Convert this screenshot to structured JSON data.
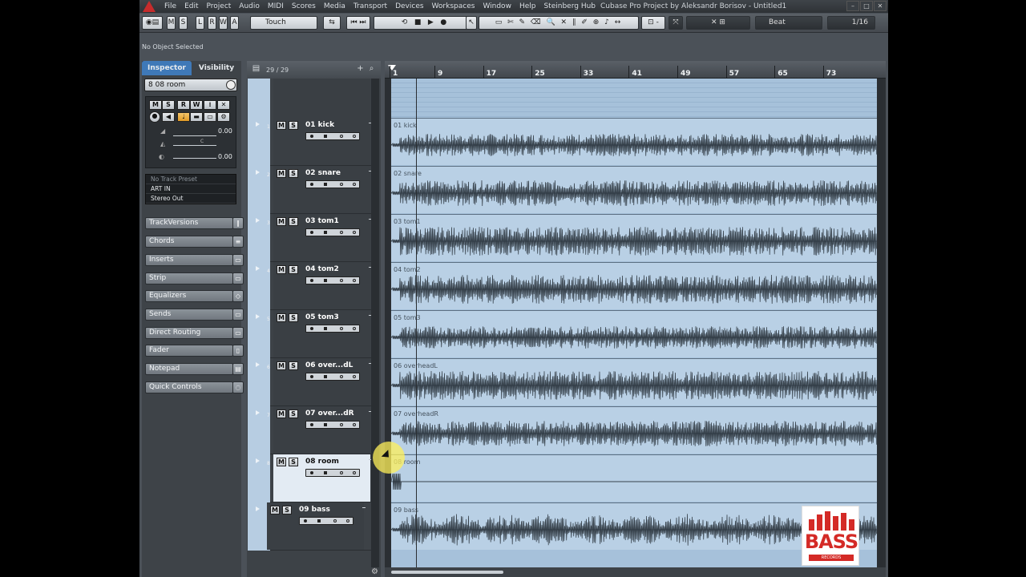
{
  "menubar": {
    "items": [
      "File",
      "Edit",
      "Project",
      "Audio",
      "MIDI",
      "Scores",
      "Media",
      "Transport",
      "Devices",
      "Workspaces",
      "Window",
      "Help",
      "Steinberg Hub"
    ],
    "window_title": "Cubase Pro Project by Aleksandr Borisov - Untitled1"
  },
  "toolbar": {
    "states": [
      "M",
      "S",
      "L",
      "R",
      "W",
      "A"
    ],
    "automation_mode": "Touch",
    "snap_type": "Beat",
    "quantize": "1/16"
  },
  "infoline": {
    "text": "No Object Selected"
  },
  "inspector": {
    "tabs": [
      "Inspector",
      "Visibility"
    ],
    "track_name": "08 room",
    "track_num": "8",
    "volume": "0.00",
    "pan": "C",
    "delay": "0.00",
    "track_preset": "No Track Preset",
    "input": "ART IN",
    "output": "Stereo Out",
    "sections": [
      "TrackVersions",
      "Chords",
      "Inserts",
      "Strip",
      "Equalizers",
      "Sends",
      "Direct Routing",
      "Fader",
      "Notepad",
      "Quick Controls"
    ]
  },
  "tracklist": {
    "count": "29 / 29",
    "tracks": [
      {
        "num": "1",
        "name": "01 kick"
      },
      {
        "num": "2",
        "name": "02 snare"
      },
      {
        "num": "3",
        "name": "03 tom1"
      },
      {
        "num": "4",
        "name": "04 tom2"
      },
      {
        "num": "5",
        "name": "05 tom3"
      },
      {
        "num": "6",
        "name": "06 over...dL"
      },
      {
        "num": "7",
        "name": "07 over...dR"
      },
      {
        "num": "8",
        "name": "08 room"
      },
      {
        "num": "9",
        "name": "09 bass"
      }
    ]
  },
  "ruler": {
    "bars": [
      "1",
      "9",
      "17",
      "25",
      "33",
      "41",
      "49",
      "57",
      "65",
      "73"
    ]
  },
  "events": [
    {
      "label": "01 kick"
    },
    {
      "label": "02 snare"
    },
    {
      "label": "03 tom1"
    },
    {
      "label": "04 tom2"
    },
    {
      "label": "05 tom3"
    },
    {
      "label": "06 overheadL"
    },
    {
      "label": "07 overheadR"
    },
    {
      "label": "08 room"
    },
    {
      "label": "09 bass"
    }
  ],
  "logo": {
    "text": "BASS",
    "sub": "RECORDS"
  },
  "colors": {
    "track_color": "#b7cde2",
    "event_bg": "#b9d0e5",
    "inspector_tab": "#3f79b8",
    "logo_red": "#d42a26"
  }
}
